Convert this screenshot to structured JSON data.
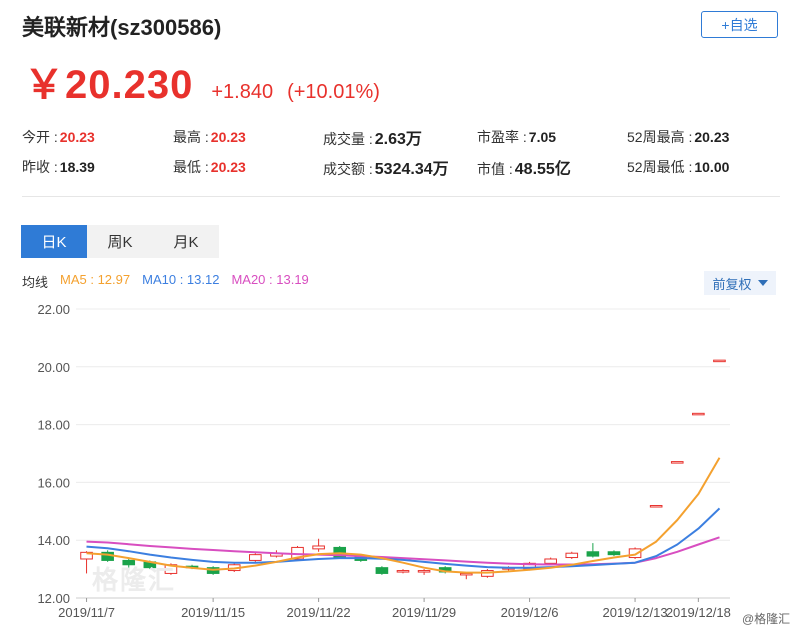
{
  "header": {
    "title": "美联新材(sz300586)",
    "add_label": "+自选",
    "price": "￥20.230",
    "change": "+1.840",
    "change_pct": "(+10.01%)"
  },
  "stats": {
    "row1": [
      {
        "label": "今开 : ",
        "value": "20.23",
        "color": "red"
      },
      {
        "label": "最高 : ",
        "value": "20.23",
        "color": "red"
      },
      {
        "label": "成交量 : ",
        "value": "2.63万",
        "color": "dark"
      },
      {
        "label": "市盈率 : ",
        "value": "7.05",
        "color": "dark"
      },
      {
        "label": "52周最高 : ",
        "value": "20.23",
        "color": "dark"
      }
    ],
    "row2": [
      {
        "label": "昨收 : ",
        "value": "18.39",
        "color": "dark"
      },
      {
        "label": "最低 : ",
        "value": "20.23",
        "color": "red"
      },
      {
        "label": "成交额 : ",
        "value": "5324.34万",
        "color": "dark"
      },
      {
        "label": "市值 : ",
        "value": "48.55亿",
        "color": "dark"
      },
      {
        "label": "52周最低 : ",
        "value": "10.00",
        "color": "dark"
      }
    ]
  },
  "tabs": [
    "日K",
    "周K",
    "月K"
  ],
  "legend": {
    "lead": "均线",
    "ma5": "MA5 : 12.97",
    "ma10": "MA10 : 13.12",
    "ma20": "MA20 : 13.19"
  },
  "fuquan_label": "前复权",
  "watermark": "格隆汇",
  "brand": "@格隆汇",
  "colors": {
    "up": "#e8312c",
    "down": "#1aa34a",
    "ma5": "#f4a12f",
    "ma10": "#3c7fe0",
    "ma20": "#d84ec0",
    "accent": "#2f7bd6"
  },
  "chart_data": {
    "type": "candlestick",
    "ylim": [
      12,
      22
    ],
    "yticks": [
      "22.00",
      "20.00",
      "18.00",
      "16.00",
      "14.00",
      "12.00"
    ],
    "xticks": [
      "2019/11/7",
      "2019/11/15",
      "2019/11/22",
      "2019/11/29",
      "2019/12/6",
      "2019/12/13",
      "2019/12/18"
    ],
    "dates": [
      "2019/11/7",
      "2019/11/8",
      "2019/11/11",
      "2019/11/12",
      "2019/11/13",
      "2019/11/14",
      "2019/11/15",
      "2019/11/18",
      "2019/11/19",
      "2019/11/20",
      "2019/11/21",
      "2019/11/22",
      "2019/11/25",
      "2019/11/26",
      "2019/11/27",
      "2019/11/28",
      "2019/11/29",
      "2019/12/2",
      "2019/12/3",
      "2019/12/4",
      "2019/12/5",
      "2019/12/6",
      "2019/12/9",
      "2019/12/10",
      "2019/12/11",
      "2019/12/12",
      "2019/12/13",
      "2019/12/16",
      "2019/12/17",
      "2019/12/18"
    ],
    "candles": [
      [
        13.35,
        13.58,
        13.62,
        12.85
      ],
      [
        13.58,
        13.3,
        13.65,
        13.25
      ],
      [
        13.3,
        13.15,
        13.4,
        13.05
      ],
      [
        13.25,
        13.05,
        13.3,
        13.0
      ],
      [
        12.85,
        13.15,
        13.2,
        12.8
      ],
      [
        13.1,
        13.05,
        13.15,
        13.0
      ],
      [
        13.05,
        12.85,
        13.1,
        12.8
      ],
      [
        12.95,
        13.15,
        13.2,
        12.9
      ],
      [
        13.3,
        13.5,
        13.55,
        13.25
      ],
      [
        13.45,
        13.55,
        13.65,
        13.4
      ],
      [
        13.35,
        13.75,
        13.8,
        13.3
      ],
      [
        13.7,
        13.8,
        14.05,
        13.6
      ],
      [
        13.75,
        13.4,
        13.8,
        13.35
      ],
      [
        13.45,
        13.3,
        13.5,
        13.25
      ],
      [
        13.05,
        12.85,
        13.1,
        12.8
      ],
      [
        12.9,
        12.95,
        13.0,
        12.85
      ],
      [
        12.9,
        12.95,
        13.0,
        12.8
      ],
      [
        13.05,
        12.9,
        13.1,
        12.85
      ],
      [
        12.8,
        12.85,
        12.9,
        12.65
      ],
      [
        12.75,
        12.95,
        13.0,
        12.7
      ],
      [
        13.0,
        13.05,
        13.1,
        12.95
      ],
      [
        13.0,
        13.2,
        13.25,
        12.95
      ],
      [
        13.2,
        13.35,
        13.4,
        13.15
      ],
      [
        13.4,
        13.55,
        13.6,
        13.35
      ],
      [
        13.6,
        13.45,
        13.9,
        13.4
      ],
      [
        13.6,
        13.5,
        13.65,
        13.45
      ],
      [
        13.4,
        13.7,
        13.75,
        13.35
      ],
      [
        15.2,
        15.2,
        15.2,
        15.2
      ],
      [
        16.72,
        16.72,
        16.72,
        16.72
      ],
      [
        18.39,
        18.39,
        18.39,
        18.39
      ],
      [
        20.23,
        20.23,
        20.23,
        20.23
      ]
    ],
    "ma5": [
      13.55,
      13.5,
      13.38,
      13.25,
      13.12,
      13.04,
      12.98,
      13.02,
      13.12,
      13.25,
      13.4,
      13.52,
      13.55,
      13.5,
      13.38,
      13.22,
      13.05,
      12.92,
      12.88,
      12.88,
      12.92,
      12.98,
      13.05,
      13.15,
      13.28,
      13.4,
      13.5,
      13.95,
      14.7,
      15.6,
      16.85
    ],
    "ma10": [
      13.78,
      13.72,
      13.62,
      13.5,
      13.4,
      13.32,
      13.25,
      13.22,
      13.22,
      13.25,
      13.3,
      13.35,
      13.38,
      13.38,
      13.36,
      13.32,
      13.25,
      13.18,
      13.12,
      13.07,
      13.05,
      13.05,
      13.07,
      13.1,
      13.14,
      13.18,
      13.22,
      13.45,
      13.85,
      14.4,
      15.1
    ],
    "ma20": [
      13.95,
      13.92,
      13.86,
      13.8,
      13.75,
      13.7,
      13.66,
      13.62,
      13.58,
      13.55,
      13.52,
      13.5,
      13.48,
      13.45,
      13.42,
      13.38,
      13.34,
      13.3,
      13.26,
      13.22,
      13.19,
      13.17,
      13.16,
      13.16,
      13.17,
      13.19,
      13.22,
      13.38,
      13.6,
      13.85,
      14.1
    ]
  }
}
